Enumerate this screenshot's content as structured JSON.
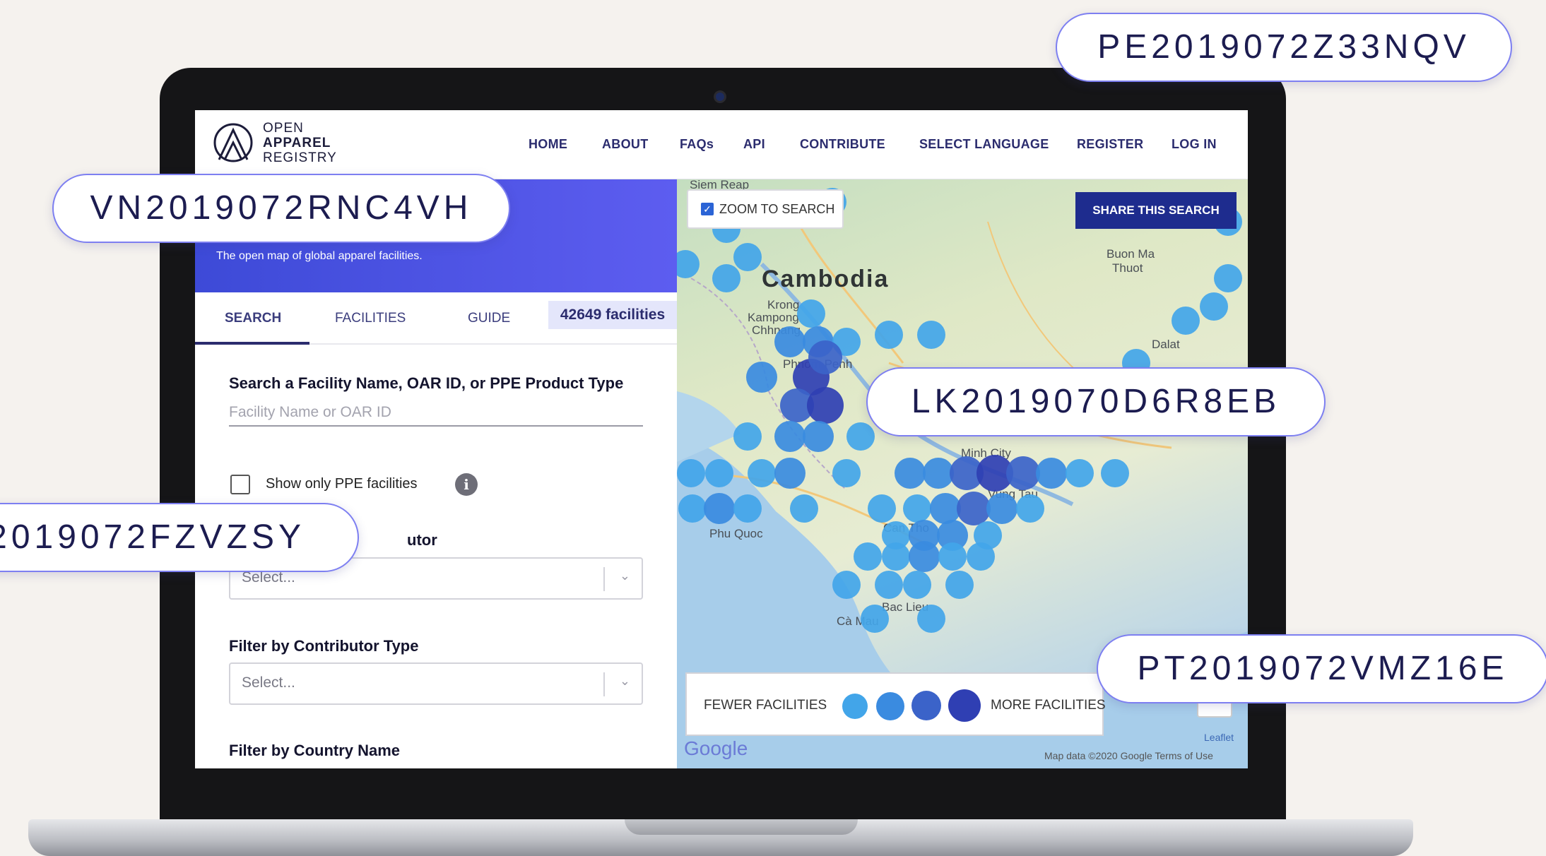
{
  "logo": {
    "line1": "OPEN",
    "line2": "APPAREL",
    "line3": "REGISTRY"
  },
  "nav": [
    "HOME",
    "ABOUT",
    "FAQs",
    "API",
    "CONTRIBUTE",
    "SELECT LANGUAGE",
    "REGISTER",
    "LOG IN"
  ],
  "hero": {
    "subtitle": "The open map of global apparel facilities."
  },
  "tabs": {
    "search": "SEARCH",
    "facilities": "FACILITIES",
    "guide": "GUIDE",
    "count": "42649 facilities"
  },
  "search": {
    "label": "Search a Facility Name, OAR ID, or PPE Product Type",
    "placeholder": "Facility Name or OAR ID",
    "ppe_label": "Show only PPE facilities",
    "info_icon": "i"
  },
  "filters": {
    "contributor_label_visible": "utor",
    "contributor_placeholder": "Select...",
    "contributor_type_label": "Filter by Contributor Type",
    "contributor_type_placeholder": "Select...",
    "country_label": "Filter by Country Name"
  },
  "map": {
    "zoom_to_search": "ZOOM TO SEARCH",
    "share": "SHARE THIS SEARCH",
    "country": "Cambodia",
    "places": {
      "siem_reap": "Siem Reap",
      "buon_ma": "Buon Ma",
      "thuot": "Thuot",
      "krong": "Krong",
      "kampong": "Kampong",
      "chhnang": "Chhnang",
      "phnom_penh": "Phnom Penh",
      "dalat": "Dalat",
      "phu_quoc": "Phu Quoc",
      "can_tho": "Can Tho",
      "vung_tau": "Vung Tau",
      "bac_lieu": "Bac Lieu",
      "ca_mau": "Cà Mau",
      "minh_city": "Minh City"
    },
    "legend_fewer": "FEWER FACILITIES",
    "legend_more": "MORE FACILITIES",
    "google": "Google",
    "attribution": "Map data ©2020 Google   Terms of Use",
    "leaflet": "Leaflet",
    "zoom_control": "−",
    "cluster_colors": [
      "#42a5e9",
      "#3a8be0",
      "#3b63c9",
      "#2f3fb3"
    ]
  },
  "ids": {
    "top_right": "PE2019072Z33NQV",
    "left_top": "VN2019072RNC4VH",
    "center": "LK2019070D6R8EB",
    "left_bottom": "2019072FZVZSY",
    "right_bottom": "PT2019072VMZ16E"
  }
}
